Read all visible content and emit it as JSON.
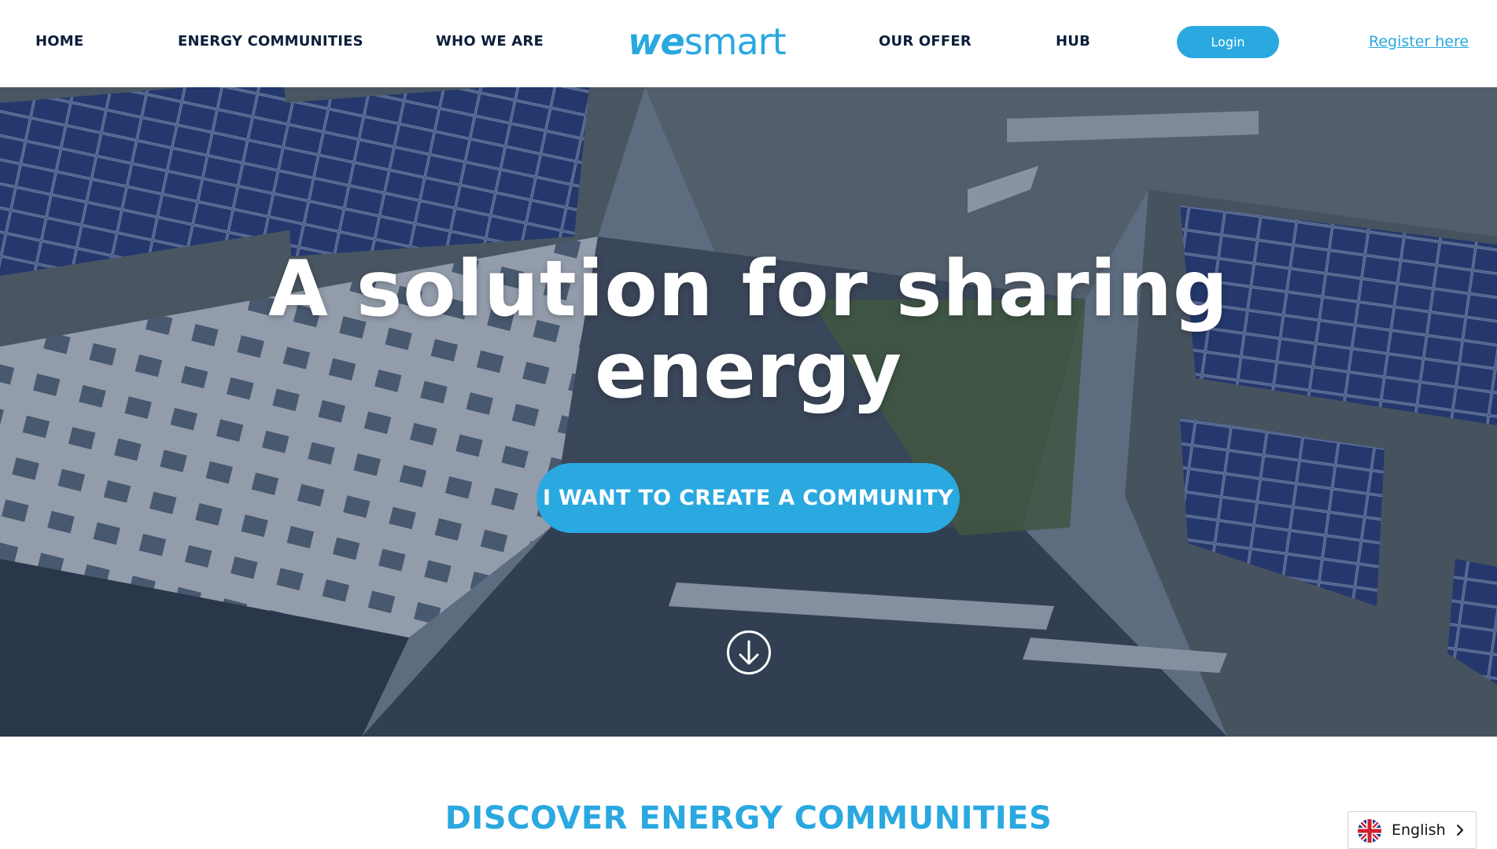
{
  "nav": {
    "home": "HOME",
    "energy_communities": "ENERGY COMMUNITIES",
    "who_we_are": "WHO WE ARE",
    "our_offer": "OUR OFFER",
    "hub": "HUB"
  },
  "logo": {
    "part1": "we",
    "part2": "smart"
  },
  "auth": {
    "login": "Login",
    "register": "Register here"
  },
  "hero": {
    "title_line1": "A solution for sharing",
    "title_line2": "energy",
    "cta": "I WANT TO CREATE A COMMUNITY"
  },
  "section": {
    "title": "DISCOVER ENERGY COMMUNITIES"
  },
  "language": {
    "current": "English",
    "flag_icon": "uk-flag-icon"
  },
  "colors": {
    "accent": "#2aa8e0",
    "nav_text": "#0b1e3b"
  }
}
